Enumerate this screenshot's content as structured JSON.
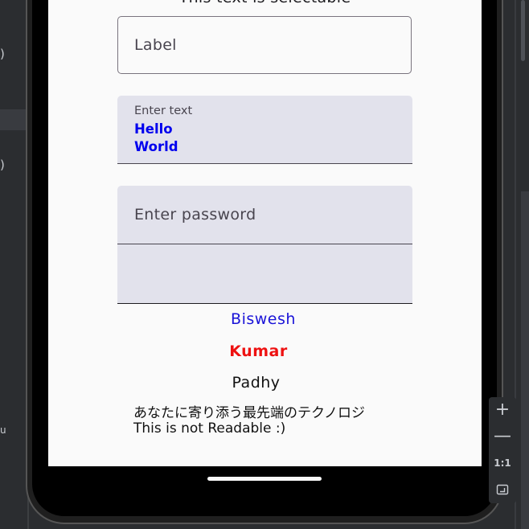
{
  "ide": {
    "left_glyph": ")",
    "left_label": "u"
  },
  "app": {
    "selectable_text": "This text is selectable",
    "outlined_field": {
      "label": "Label"
    },
    "multiline_field": {
      "label": "Enter text",
      "lines": [
        "Hello",
        "World"
      ]
    },
    "password_field": {
      "placeholder": "Enter password"
    },
    "names": {
      "first": "Biswesh",
      "middle": "Kumar",
      "last": "Padhy"
    },
    "japanese_text": "あなたに寄り添う最先端のテクノロジ",
    "readable_text": "This is not Readable :)"
  },
  "zoom_controls": {
    "zoom_in": "+",
    "zoom_out": "—",
    "actual_size": "1:1",
    "fit_icon": "fit-screen-icon"
  },
  "colors": {
    "first_name": "#1a13d8",
    "middle_name": "#ee1111",
    "multiline_value": "#0000ee",
    "field_fill": "#e2e2ec"
  }
}
